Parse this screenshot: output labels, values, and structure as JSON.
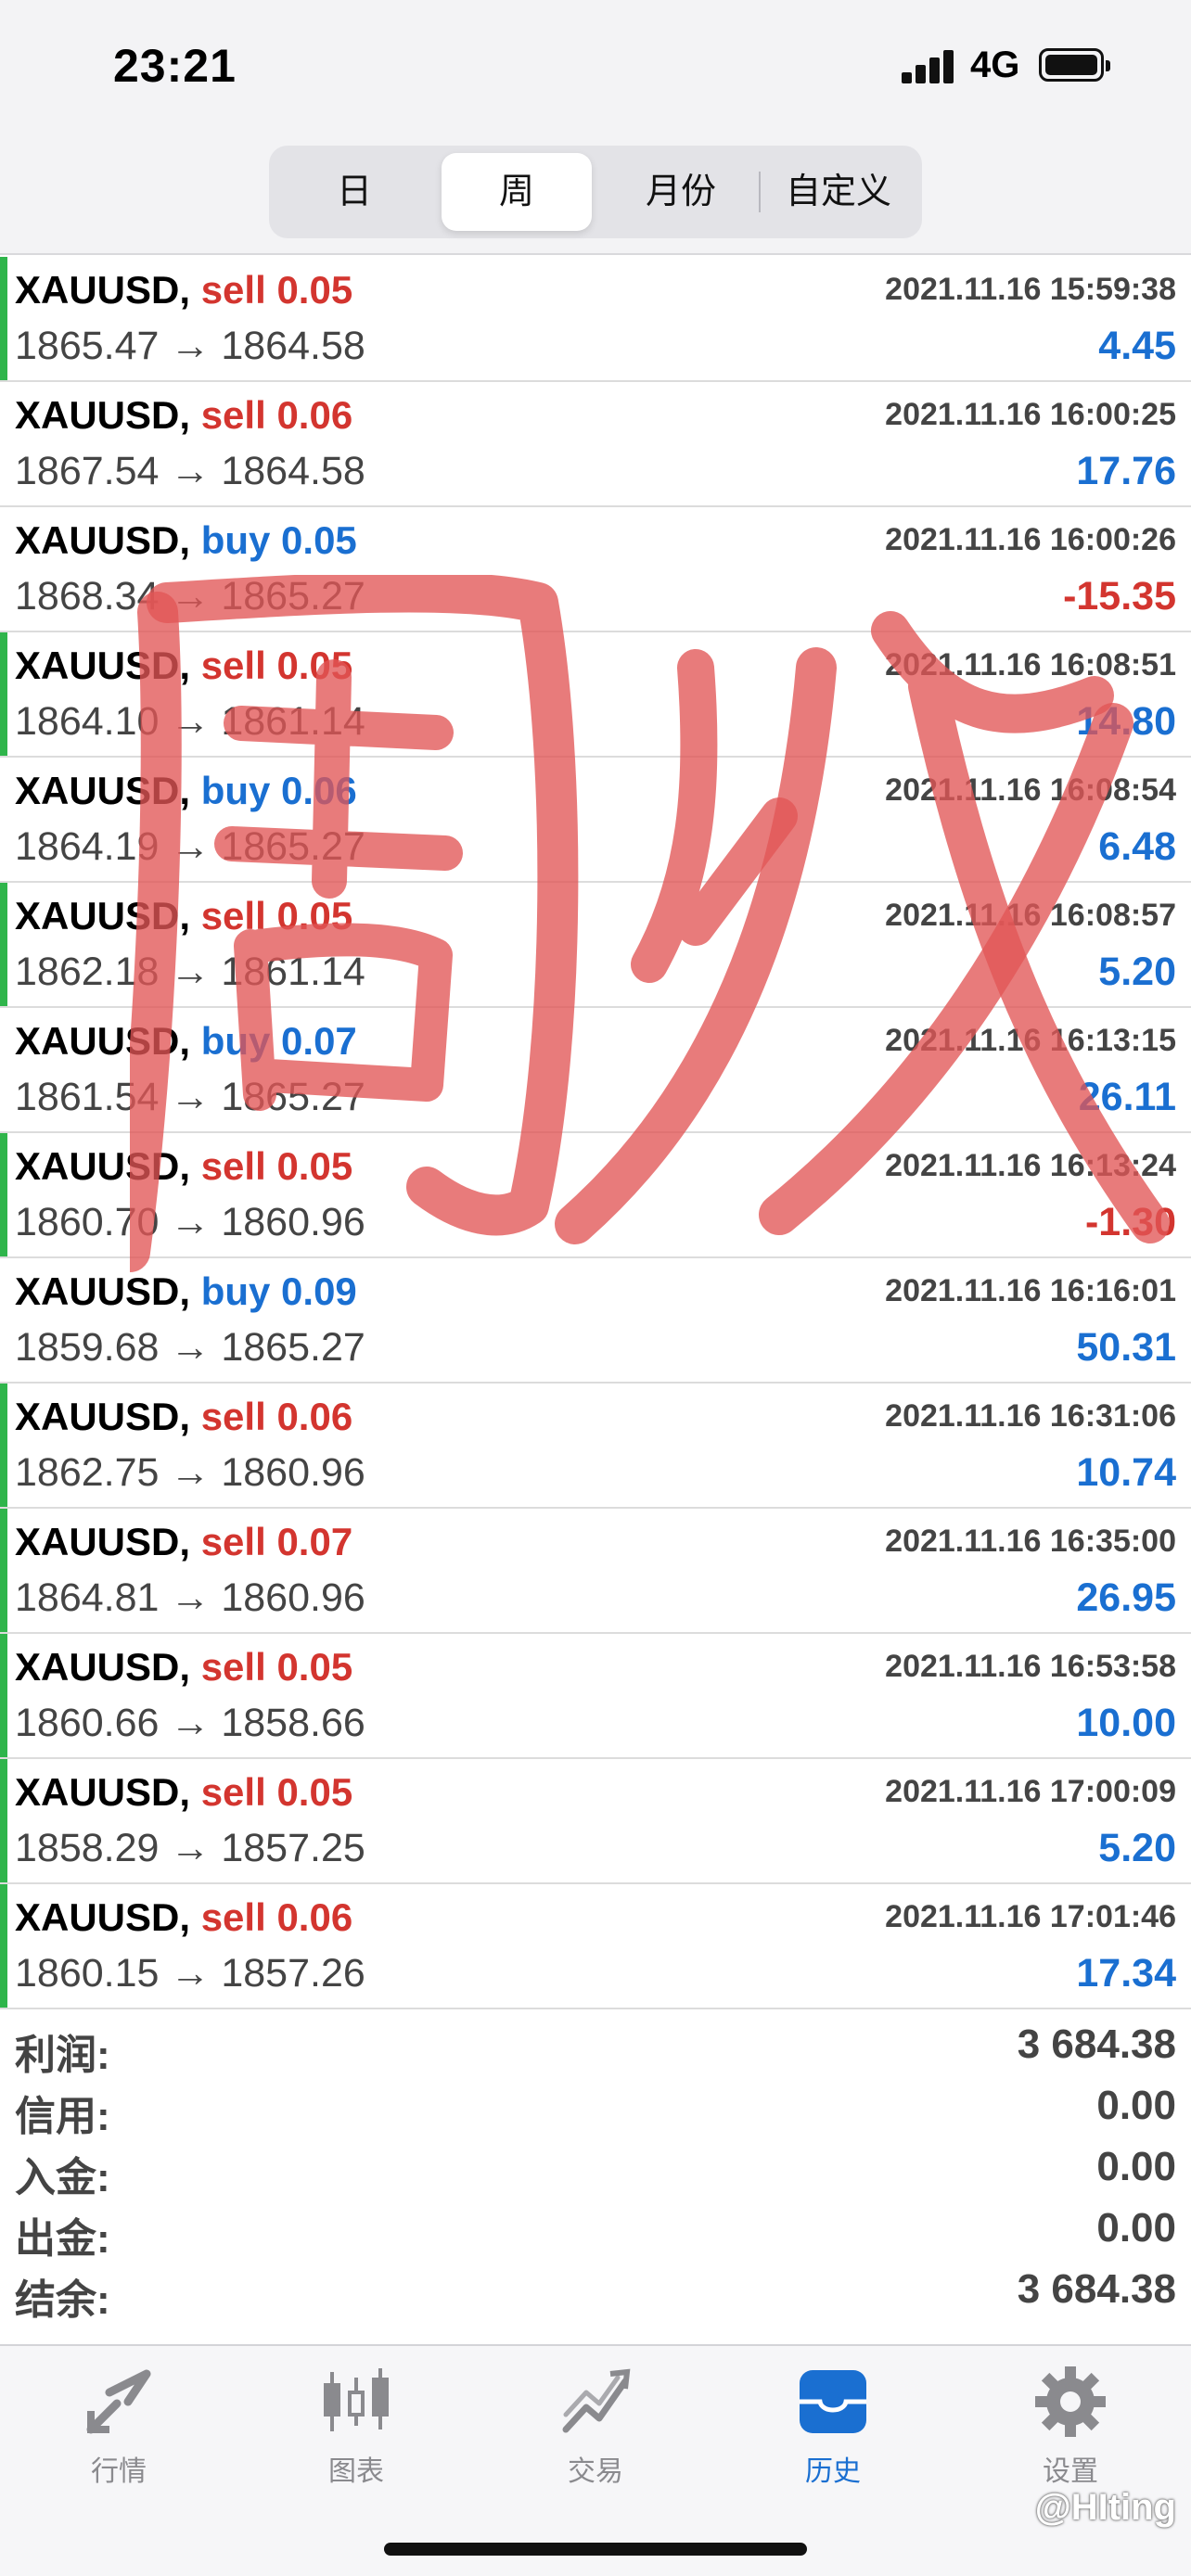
{
  "status_bar": {
    "time": "23:21",
    "network": "4G"
  },
  "period_tabs": [
    "日",
    "周",
    "月份",
    "自定义"
  ],
  "active_period": "周",
  "trades": [
    {
      "symbol": "XAUUSD,",
      "side": "sell",
      "volume": "0.05",
      "time": "2021.11.16 15:59:38",
      "open": "1865.47",
      "arrow": "→",
      "close": "1864.58",
      "profit": "4.45",
      "marked": true
    },
    {
      "symbol": "XAUUSD,",
      "side": "sell",
      "volume": "0.06",
      "time": "2021.11.16 16:00:25",
      "open": "1867.54",
      "arrow": "→",
      "close": "1864.58",
      "profit": "17.76",
      "marked": false
    },
    {
      "symbol": "XAUUSD,",
      "side": "buy",
      "volume": "0.05",
      "time": "2021.11.16 16:00:26",
      "open": "1868.34",
      "arrow": "→",
      "close": "1865.27",
      "profit": "-15.35",
      "marked": false
    },
    {
      "symbol": "XAUUSD,",
      "side": "sell",
      "volume": "0.05",
      "time": "2021.11.16 16:08:51",
      "open": "1864.10",
      "arrow": "→",
      "close": "1861.14",
      "profit": "14.80",
      "marked": true
    },
    {
      "symbol": "XAUUSD,",
      "side": "buy",
      "volume": "0.06",
      "time": "2021.11.16 16:08:54",
      "open": "1864.19",
      "arrow": "→",
      "close": "1865.27",
      "profit": "6.48",
      "marked": false
    },
    {
      "symbol": "XAUUSD,",
      "side": "sell",
      "volume": "0.05",
      "time": "2021.11.16 16:08:57",
      "open": "1862.18",
      "arrow": "→",
      "close": "1861.14",
      "profit": "5.20",
      "marked": true
    },
    {
      "symbol": "XAUUSD,",
      "side": "buy",
      "volume": "0.07",
      "time": "2021.11.16 16:13:15",
      "open": "1861.54",
      "arrow": "→",
      "close": "1865.27",
      "profit": "26.11",
      "marked": false
    },
    {
      "symbol": "XAUUSD,",
      "side": "sell",
      "volume": "0.05",
      "time": "2021.11.16 16:13:24",
      "open": "1860.70",
      "arrow": "→",
      "close": "1860.96",
      "profit": "-1.30",
      "marked": true
    },
    {
      "symbol": "XAUUSD,",
      "side": "buy",
      "volume": "0.09",
      "time": "2021.11.16 16:16:01",
      "open": "1859.68",
      "arrow": "→",
      "close": "1865.27",
      "profit": "50.31",
      "marked": false
    },
    {
      "symbol": "XAUUSD,",
      "side": "sell",
      "volume": "0.06",
      "time": "2021.11.16 16:31:06",
      "open": "1862.75",
      "arrow": "→",
      "close": "1860.96",
      "profit": "10.74",
      "marked": true
    },
    {
      "symbol": "XAUUSD,",
      "side": "sell",
      "volume": "0.07",
      "time": "2021.11.16 16:35:00",
      "open": "1864.81",
      "arrow": "→",
      "close": "1860.96",
      "profit": "26.95",
      "marked": true
    },
    {
      "symbol": "XAUUSD,",
      "side": "sell",
      "volume": "0.05",
      "time": "2021.11.16 16:53:58",
      "open": "1860.66",
      "arrow": "→",
      "close": "1858.66",
      "profit": "10.00",
      "marked": true
    },
    {
      "symbol": "XAUUSD,",
      "side": "sell",
      "volume": "0.05",
      "time": "2021.11.16 17:00:09",
      "open": "1858.29",
      "arrow": "→",
      "close": "1857.25",
      "profit": "5.20",
      "marked": true
    },
    {
      "symbol": "XAUUSD,",
      "side": "sell",
      "volume": "0.06",
      "time": "2021.11.16 17:01:46",
      "open": "1860.15",
      "arrow": "→",
      "close": "1857.26",
      "profit": "17.34",
      "marked": true
    }
  ],
  "summary": [
    {
      "label": "利润:",
      "value": "3 684.38"
    },
    {
      "label": "信用:",
      "value": "0.00"
    },
    {
      "label": "入金:",
      "value": "0.00"
    },
    {
      "label": "出金:",
      "value": "0.00"
    },
    {
      "label": "结余:",
      "value": "3 684.38"
    }
  ],
  "stamp_text": "周收",
  "tabs": [
    {
      "label": "行情",
      "icon": "quotes-icon"
    },
    {
      "label": "图表",
      "icon": "chart-icon"
    },
    {
      "label": "交易",
      "icon": "trade-icon"
    },
    {
      "label": "历史",
      "icon": "history-icon"
    },
    {
      "label": "设置",
      "icon": "settings-icon"
    }
  ],
  "active_tab": "历史",
  "credit": "@HIting",
  "colors": {
    "sell": "#d3352f",
    "buy": "#1a6fd1",
    "loss": "#d3352f",
    "profit": "#1a6fd1",
    "marker": "#2fb54b",
    "stamp": "#e05a5a"
  }
}
